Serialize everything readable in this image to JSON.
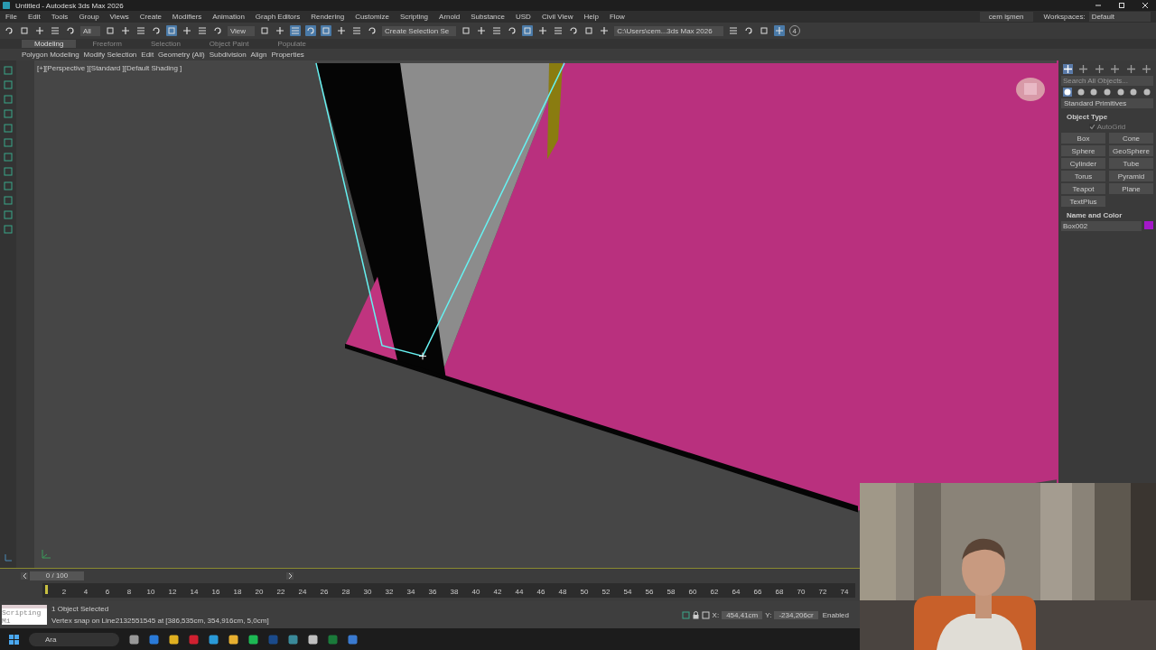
{
  "window": {
    "title": "Untitled - Autodesk 3ds Max 2026"
  },
  "menu": [
    "File",
    "Edit",
    "Tools",
    "Group",
    "Views",
    "Create",
    "Modifiers",
    "Animation",
    "Graph Editors",
    "Rendering",
    "Customize",
    "Scripting",
    "Arnold",
    "Substance",
    "USD",
    "Civil View",
    "Help",
    "Flow"
  ],
  "account": {
    "user": "cem işmen",
    "workspaces_label": "Workspaces:",
    "workspace": "Default"
  },
  "toolbar": {
    "selection_filter": "All",
    "reference_coord": "View",
    "named_selection": "Create Selection Se",
    "project_path": "C:\\Users\\cem...3ds Max 2026",
    "badge": "4",
    "tools": [
      {
        "on": false
      },
      {
        "on": false
      },
      {
        "on": false
      },
      {
        "on": false
      },
      {
        "on": false
      },
      {
        "on": false
      },
      {
        "on": false
      },
      {
        "on": false
      },
      {
        "on": false
      },
      {
        "on": true
      },
      {
        "on": false
      },
      {
        "on": false
      },
      {
        "on": false
      },
      {
        "on": false
      },
      {
        "on": false
      },
      {
        "on": true
      },
      {
        "on": true
      },
      {
        "on": true
      },
      {
        "on": false
      },
      {
        "on": false
      },
      {
        "on": false
      },
      {
        "on": false
      },
      {
        "on": false
      },
      {
        "on": false
      },
      {
        "on": false
      },
      {
        "on": true
      },
      {
        "on": false
      },
      {
        "on": false
      },
      {
        "on": false
      },
      {
        "on": false
      },
      {
        "on": false
      },
      {
        "on": false
      },
      {
        "on": false
      },
      {
        "on": false
      },
      {
        "on": true
      }
    ]
  },
  "ribbon": {
    "tabs": [
      {
        "label": "Modeling",
        "selected": true
      },
      {
        "label": "Freeform",
        "selected": false
      },
      {
        "label": "Selection",
        "selected": false
      },
      {
        "label": "Object Paint",
        "selected": false
      },
      {
        "label": "Populate",
        "selected": false
      }
    ],
    "panels": [
      "Polygon Modeling",
      "Modify Selection",
      "Edit",
      "Geometry (All)",
      "Subdivision",
      "Align",
      "Properties"
    ]
  },
  "viewport": {
    "label": "[+][Perspective ][Standard ][Default Shading ]"
  },
  "command_panel": {
    "tabs": [
      {
        "selected": true
      },
      {
        "selected": false
      },
      {
        "selected": false
      },
      {
        "selected": false
      },
      {
        "selected": false
      },
      {
        "selected": false
      }
    ],
    "search": {
      "placeholder": "Search All Objects..."
    },
    "categories": [
      {
        "selected": true
      },
      {
        "selected": false
      },
      {
        "selected": false
      },
      {
        "selected": false
      },
      {
        "selected": false
      },
      {
        "selected": false
      },
      {
        "selected": false
      }
    ],
    "type": "Standard Primitives",
    "object_type": {
      "title": "Object Type",
      "autogrid": {
        "label": "AutoGrid",
        "checked": true
      },
      "buttons": [
        "Box",
        "Cone",
        "Sphere",
        "GeoSphere",
        "Cylinder",
        "Tube",
        "Torus",
        "Pyramid",
        "Teapot",
        "Plane",
        "TextPlus"
      ]
    },
    "name_and_color": {
      "title": "Name and Color",
      "name": "Box002",
      "color": "#a418c8"
    }
  },
  "timeline": {
    "range": "0 / 100",
    "frames": [
      "2",
      "4",
      "6",
      "8",
      "10",
      "12",
      "14",
      "16",
      "18",
      "20",
      "22",
      "24",
      "26",
      "28",
      "30",
      "32",
      "34",
      "36",
      "38",
      "40",
      "42",
      "44",
      "46",
      "48",
      "50",
      "52",
      "54",
      "56",
      "58",
      "60",
      "62",
      "64",
      "66",
      "68",
      "70",
      "72",
      "74"
    ]
  },
  "status": {
    "script": "Scripting Mi",
    "selection": "1 Object Selected",
    "prompt": "Vertex snap on Line2132551545 at [386,535cm, 354,916cm, 5,0cm]",
    "x_label": "X:",
    "x": "454,41cm",
    "y_label": "Y:",
    "y": "-234,206cr",
    "enabled": "Enabled"
  },
  "taskbar": {
    "search": "Ara"
  }
}
